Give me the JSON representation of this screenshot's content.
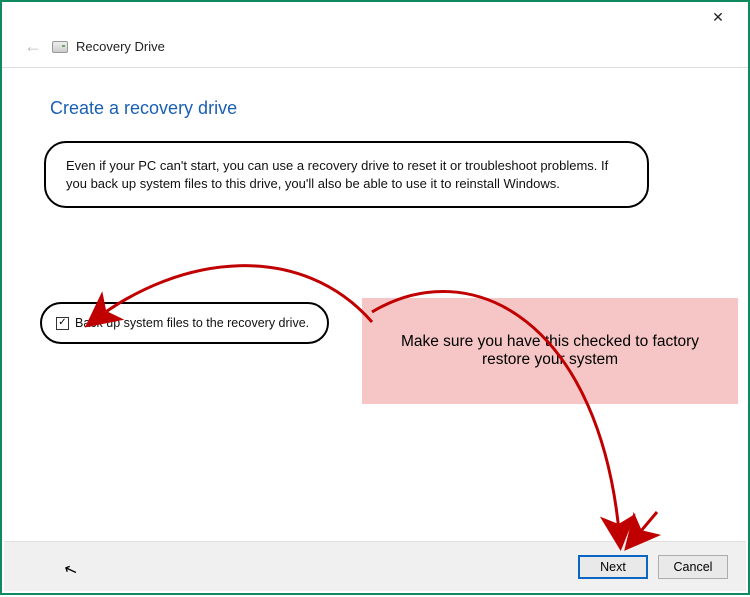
{
  "header": {
    "wizard_title": "Recovery Drive"
  },
  "page": {
    "heading": "Create a recovery drive",
    "description": "Even if your PC can't start, you can use a recovery drive to reset it or troubleshoot problems. If you back up system files to this drive, you'll also be able to use it to reinstall Windows."
  },
  "checkbox": {
    "label": "Back up system files to the recovery drive.",
    "checked": true
  },
  "annotation": {
    "text": "Make sure you have this checked to factory restore your system"
  },
  "footer": {
    "next_label": "Next",
    "cancel_label": "Cancel"
  }
}
